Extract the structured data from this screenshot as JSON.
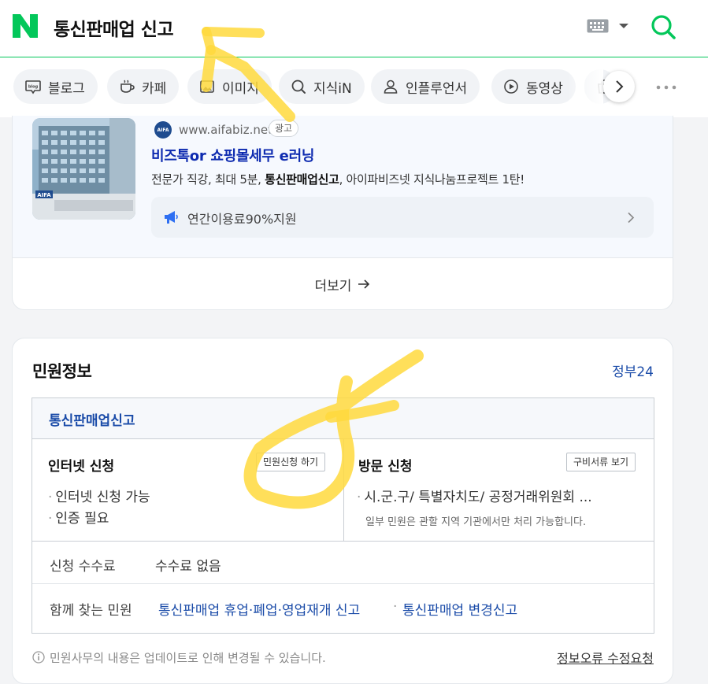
{
  "header": {
    "logo_letter": "N",
    "query": "통신판매업 신고"
  },
  "tabs": [
    {
      "label": "블로그",
      "icon": "blog-icon"
    },
    {
      "label": "카페",
      "icon": "cafe-cup-icon"
    },
    {
      "label": "이미지",
      "icon": "image-icon"
    },
    {
      "label": "지식iN",
      "icon": "kin-search-icon"
    },
    {
      "label": "인플루언서",
      "icon": "person-icon"
    },
    {
      "label": "동영상",
      "icon": "play-icon"
    }
  ],
  "ad": {
    "favicon_text": "AIFA",
    "url": "www.aifabiz.net",
    "badge": "광고",
    "title": "비즈톡or 쇼핑몰세무 e러닝",
    "desc_pre": "전문가 직강, 최대 5분, ",
    "desc_bold": "통신판매업신고",
    "desc_post": ", 아이파비즈넷 지식나눔프로젝트 1탄!",
    "extension": "연간이용료90%지원",
    "thumb_sign_text": "AIFA"
  },
  "more_label": "더보기",
  "civil": {
    "title": "민원정보",
    "source": "정부24",
    "item_title": "통신판매업신고",
    "internet": {
      "title": "인터넷 신청",
      "button": "민원신청 하기",
      "items": [
        "인터넷 신청 가능",
        "인증 필요"
      ]
    },
    "visit": {
      "title": "방문 신청",
      "button": "구비서류 보기",
      "item": "시.군.구/ 특별자치도/ 공정거래위원회 ...",
      "note": "일부 민원은 관할 지역 기관에서만 처리 가능합니다."
    },
    "fee_label": "신청 수수료",
    "fee_value": "수수료 없음",
    "related_label": "함께 찾는 민원",
    "related": [
      "통신판매업 휴업·폐업·영업재개 신고",
      "통신판매업 변경신고"
    ],
    "footer_note": "민원사무의 내용은 업데이트로 인해 변경될 수 있습니다.",
    "report_link": "정보오류 수정요청"
  },
  "colors": {
    "naver_green": "#03c75a",
    "link_blue": "#1a4ba8",
    "ad_title_blue": "#0e2bb0",
    "annotation_yellow": "#ffd93d"
  }
}
